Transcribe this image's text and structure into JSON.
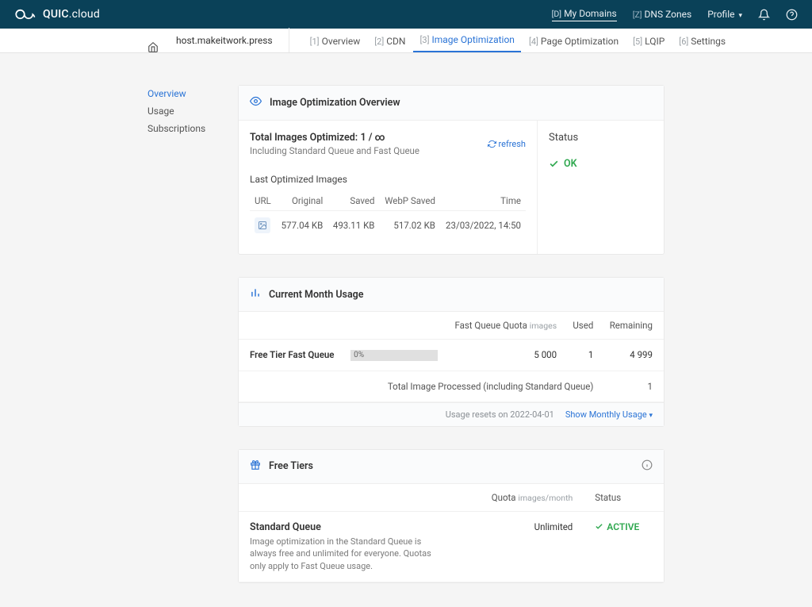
{
  "brand": {
    "name_html": "QUIC.cloud"
  },
  "topnav": {
    "my_domains": {
      "prefix": "[D]",
      "label": "My Domains"
    },
    "dns_zones": {
      "prefix": "[Z]",
      "label": "DNS Zones"
    },
    "profile": "Profile"
  },
  "domain": "host.makeitwork.press",
  "tabs": [
    {
      "prefix": "[1]",
      "label": "Overview"
    },
    {
      "prefix": "[2]",
      "label": "CDN"
    },
    {
      "prefix": "[3]",
      "label": "Image Optimization"
    },
    {
      "prefix": "[4]",
      "label": "Page Optimization"
    },
    {
      "prefix": "[5]",
      "label": "LQIP"
    },
    {
      "prefix": "[6]",
      "label": "Settings"
    }
  ],
  "sidebar": [
    "Overview",
    "Usage",
    "Subscriptions"
  ],
  "overview": {
    "card_title": "Image Optimization Overview",
    "total_label": "Total Images Optimized:",
    "total_value": "1 / ∞",
    "total_sub": "Including Standard Queue and Fast Queue",
    "refresh": "refresh",
    "status_label": "Status",
    "status_value": "OK",
    "last_title": "Last Optimized Images",
    "headers": [
      "URL",
      "Original",
      "Saved",
      "WebP Saved",
      "Time"
    ],
    "row": {
      "original": "577.04 KB",
      "saved": "493.11 KB",
      "webp": "517.02 KB",
      "time": "23/03/2022, 14:50"
    }
  },
  "usage": {
    "card_title": "Current Month Usage",
    "headers": {
      "quota": "Fast Queue Quota",
      "quota_unit": "images",
      "used": "Used",
      "remaining": "Remaining"
    },
    "row_label": "Free Tier Fast Queue",
    "bar_pct": "0%",
    "quota": "5 000",
    "used": "1",
    "remaining": "4 999",
    "processed_label": "Total Image Processed (including Standard Queue)",
    "processed_value": "1",
    "resets": "Usage resets on 2022-04-01",
    "show_link": "Show Monthly Usage"
  },
  "tiers": {
    "card_title": "Free Tiers",
    "headers": {
      "quota": "Quota",
      "quota_unit": "images/month",
      "status": "Status"
    },
    "row": {
      "name": "Standard Queue",
      "desc": "Image optimization in the Standard Queue is always free and unlimited for everyone. Quotas only apply to Fast Queue usage.",
      "quota": "Unlimited",
      "status": "ACTIVE"
    }
  }
}
